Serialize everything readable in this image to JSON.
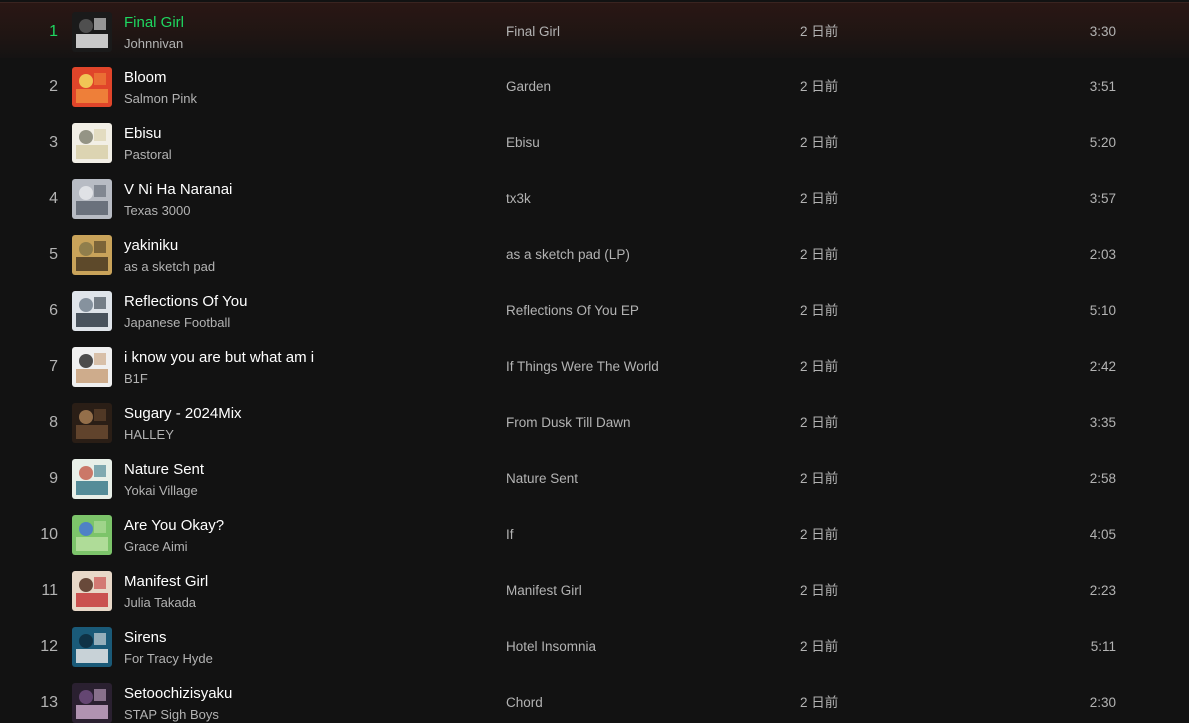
{
  "tracks": [
    {
      "index": "1",
      "title": "Final Girl",
      "artist": "Johnnivan",
      "album": "Final Girl",
      "added": "2 日前",
      "duration": "3:30",
      "playing": true,
      "cover_colors": [
        "#1a1a1a",
        "#e8e8e8",
        "#555555"
      ]
    },
    {
      "index": "2",
      "title": "Bloom",
      "artist": "Salmon Pink",
      "album": "Garden",
      "added": "2 日前",
      "duration": "3:51",
      "playing": false,
      "cover_colors": [
        "#e0452a",
        "#f08a3c",
        "#f3d35a"
      ]
    },
    {
      "index": "3",
      "title": "Ebisu",
      "artist": "Pastoral",
      "album": "Ebisu",
      "added": "2 日前",
      "duration": "5:20",
      "playing": false,
      "cover_colors": [
        "#f2efe6",
        "#d8cfa8",
        "#8a8a7a"
      ]
    },
    {
      "index": "4",
      "title": "V Ni Ha Naranai",
      "artist": "Texas 3000",
      "album": "tx3k",
      "added": "2 日前",
      "duration": "3:57",
      "playing": false,
      "cover_colors": [
        "#b8bcc4",
        "#5c6470",
        "#e4e6ea"
      ]
    },
    {
      "index": "5",
      "title": "yakiniku",
      "artist": "as a sketch pad",
      "album": "as a sketch pad (LP)",
      "added": "2 日前",
      "duration": "2:03",
      "playing": false,
      "cover_colors": [
        "#c9a35a",
        "#4a3a22",
        "#8a7a4a"
      ]
    },
    {
      "index": "6",
      "title": "Reflections Of You",
      "artist": "Japanese Football",
      "album": "Reflections Of You EP",
      "added": "2 日前",
      "duration": "5:10",
      "playing": false,
      "cover_colors": [
        "#dfe4ea",
        "#2f3a44",
        "#7c8896"
      ]
    },
    {
      "index": "7",
      "title": "i know you are but what am i",
      "artist": "B1F",
      "album": "If Things Were The World",
      "added": "2 日前",
      "duration": "2:42",
      "playing": false,
      "cover_colors": [
        "#f0f0f0",
        "#c8a07a",
        "#3a3a3a"
      ]
    },
    {
      "index": "8",
      "title": "Sugary - 2024Mix",
      "artist": "HALLEY",
      "album": "From Dusk Till Dawn",
      "added": "2 日前",
      "duration": "3:35",
      "playing": false,
      "cover_colors": [
        "#2a1e16",
        "#6a4a30",
        "#a07850"
      ]
    },
    {
      "index": "9",
      "title": "Nature Sent",
      "artist": "Yokai Village",
      "album": "Nature Sent",
      "added": "2 日前",
      "duration": "2:58",
      "playing": false,
      "cover_colors": [
        "#e8efe8",
        "#3a7a8a",
        "#c86a5a"
      ]
    },
    {
      "index": "10",
      "title": "Are You Okay?",
      "artist": "Grace Aimi",
      "album": "If",
      "added": "2 日前",
      "duration": "4:05",
      "playing": false,
      "cover_colors": [
        "#7cc46a",
        "#b8e0a0",
        "#4a7ad0"
      ]
    },
    {
      "index": "11",
      "title": "Manifest Girl",
      "artist": "Julia Takada",
      "album": "Manifest Girl",
      "added": "2 日前",
      "duration": "2:23",
      "playing": false,
      "cover_colors": [
        "#e8d8c8",
        "#c43a3a",
        "#5a3a2a"
      ]
    },
    {
      "index": "12",
      "title": "Sirens",
      "artist": "For Tracy Hyde",
      "album": "Hotel Insomnia",
      "added": "2 日前",
      "duration": "5:11",
      "playing": false,
      "cover_colors": [
        "#1a5a78",
        "#e8e8e8",
        "#0e2e40"
      ]
    },
    {
      "index": "13",
      "title": "Setoochizisyaku",
      "artist": "STAP Sigh Boys",
      "album": "Chord",
      "added": "2 日前",
      "duration": "2:30",
      "playing": false,
      "cover_colors": [
        "#2a2030",
        "#c8a8c8",
        "#6a4a7a"
      ]
    }
  ]
}
